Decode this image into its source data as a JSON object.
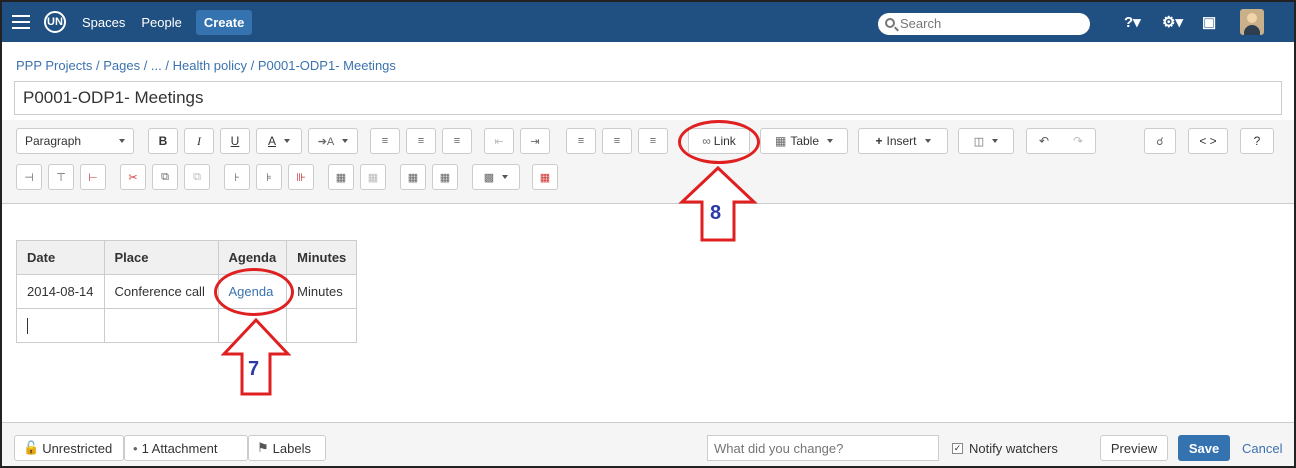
{
  "topnav": {
    "logo": "UN",
    "spaces": "Spaces",
    "people": "People",
    "create": "Create",
    "search_placeholder": "Search",
    "icons": [
      "help-icon",
      "gear-icon",
      "notifications-icon",
      "avatar"
    ]
  },
  "breadcrumb": {
    "items": [
      "PPP Projects",
      "Pages",
      "...",
      "Health policy",
      "P0001-ODP1- Meetings"
    ],
    "separator": " / "
  },
  "page_title": "P0001-ODP1- Meetings",
  "toolbar": {
    "paragraph": "Paragraph",
    "link": "Link",
    "table": "Table",
    "insert": "Insert",
    "source": "< >",
    "help": "?"
  },
  "table": {
    "headers": [
      "Date",
      "Place",
      "Agenda",
      "Minutes"
    ],
    "rows": [
      [
        "2014-08-14",
        "Conference call",
        "Agenda",
        "Minutes"
      ],
      [
        "",
        "",
        "",
        ""
      ]
    ]
  },
  "annotations": {
    "seven": "7",
    "eight": "8"
  },
  "footer": {
    "restrictions": "Unrestricted",
    "attachments": "1 Attachment",
    "labels": "Labels",
    "change_placeholder": "What did you change?",
    "notify": "Notify watchers",
    "preview": "Preview",
    "save": "Save",
    "cancel": "Cancel"
  },
  "colors": {
    "header": "#205081",
    "accent": "#3572b0",
    "link": "#3b73af",
    "annotation": "#e02020"
  }
}
